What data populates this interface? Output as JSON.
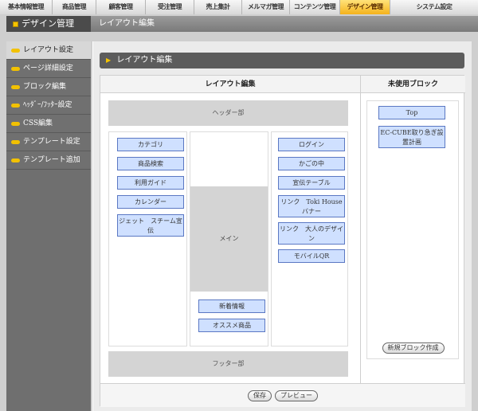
{
  "topnav": {
    "tabs": [
      {
        "label": "基本情報管理"
      },
      {
        "label": "商品管理"
      },
      {
        "label": "顧客管理"
      },
      {
        "label": "受注管理"
      },
      {
        "label": "売上集計"
      },
      {
        "label": "メルマガ管理"
      },
      {
        "label": "コンテンツ管理"
      },
      {
        "label": "デザイン管理"
      },
      {
        "label": "システム設定"
      }
    ],
    "active_index": 7
  },
  "header": {
    "section_title": "デザイン管理",
    "page_title": "レイアウト編集"
  },
  "sidebar": {
    "items": [
      {
        "label": "レイアウト設定"
      },
      {
        "label": "ページ詳細設定"
      },
      {
        "label": "ブロック編集"
      },
      {
        "label": "ﾍｯﾀﾞｰ/ﾌｯﾀｰ設定"
      },
      {
        "label": "CSS編集"
      },
      {
        "label": "テンプレート設定"
      },
      {
        "label": "テンプレート追加"
      }
    ],
    "active_index": 0
  },
  "main": {
    "section_bar": "レイアウト編集",
    "layout_header": "レイアウト編集",
    "unused_header": "未使用ブロック",
    "header_area": "ヘッダー部",
    "footer_area": "フッター部",
    "main_area": "メイン",
    "left_blocks": [
      "カテゴリ",
      "商品検索",
      "利用ガイド",
      "カレンダー",
      "ジェット　スチーム宣伝"
    ],
    "center_blocks": [
      "新着情報",
      "オススメ商品"
    ],
    "right_blocks": [
      "ログイン",
      "かごの中",
      "宣伝テーブル",
      "リンク　Toki House バナー",
      "リンク　大人のデザイン",
      "モバイルQR"
    ],
    "unused_blocks": [
      "Top",
      "EC-CUBE取り急ぎ設置計画"
    ],
    "new_block_button": "新規ブロック作成",
    "save_button": "保存",
    "preview_button": "プレビュー"
  },
  "colors": {
    "accent": "#f4b21c",
    "block_fill": "#cfe0ff",
    "block_border": "#5b78c3"
  }
}
